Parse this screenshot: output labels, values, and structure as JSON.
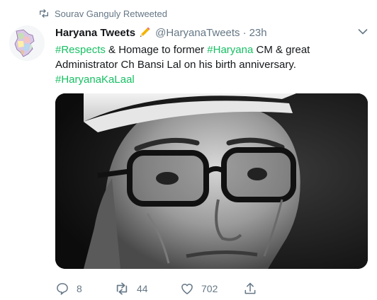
{
  "retweet_context": {
    "text": "Sourav Ganguly Retweeted"
  },
  "author": {
    "display_name": "Haryana Tweets",
    "handle": "@HaryanaTweets",
    "separator": "·",
    "time": "23h"
  },
  "tweet": {
    "segments": [
      {
        "text": "#Respects",
        "hashtag": true
      },
      {
        "text": " & Homage to former ",
        "hashtag": false
      },
      {
        "text": "#Haryana",
        "hashtag": true
      },
      {
        "text": " CM & great Administrator Ch Bansi Lal on his birth anniversary. ",
        "hashtag": false
      },
      {
        "text": "#HaryanaKaLaal",
        "hashtag": true
      }
    ]
  },
  "actions": {
    "replies": "8",
    "retweets": "44",
    "likes": "702"
  },
  "colors": {
    "hashtag": "#17bf63",
    "secondary": "#657786"
  }
}
